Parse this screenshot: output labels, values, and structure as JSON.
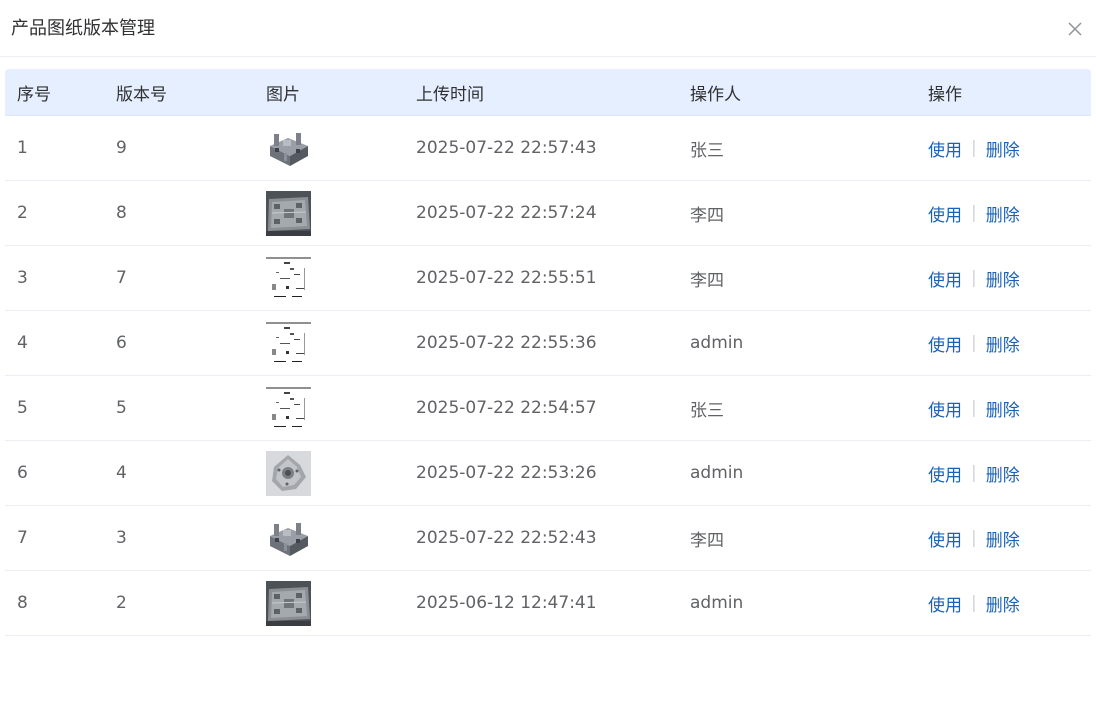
{
  "dialog": {
    "title": "产品图纸版本管理",
    "close_icon": "close-icon"
  },
  "table": {
    "headers": [
      "序号",
      "版本号",
      "图片",
      "上传时间",
      "操作人",
      "操作"
    ],
    "rows": [
      {
        "index": "1",
        "version": "9",
        "image": "mold-3d-render",
        "time": "2025-07-22 22:57:43",
        "operator": "张三"
      },
      {
        "index": "2",
        "version": "8",
        "image": "mold-plate-photo",
        "time": "2025-07-22 22:57:24",
        "operator": "李四"
      },
      {
        "index": "3",
        "version": "7",
        "image": "line-drawing",
        "time": "2025-07-22 22:55:51",
        "operator": "李四"
      },
      {
        "index": "4",
        "version": "6",
        "image": "line-drawing",
        "time": "2025-07-22 22:55:36",
        "operator": "admin"
      },
      {
        "index": "5",
        "version": "5",
        "image": "line-drawing",
        "time": "2025-07-22 22:54:57",
        "operator": "张三"
      },
      {
        "index": "6",
        "version": "4",
        "image": "metal-part-photo",
        "time": "2025-07-22 22:53:26",
        "operator": "admin"
      },
      {
        "index": "7",
        "version": "3",
        "image": "mold-3d-render",
        "time": "2025-07-22 22:52:43",
        "operator": "李四"
      },
      {
        "index": "8",
        "version": "2",
        "image": "mold-plate-photo",
        "time": "2025-06-12 12:47:41",
        "operator": "admin"
      }
    ],
    "actions": {
      "use": "使用",
      "separator": "|",
      "delete": "删除"
    }
  },
  "colors": {
    "header_bg": "#e6efff",
    "link": "#1a62b8",
    "text": "#606266",
    "title": "#303133"
  }
}
